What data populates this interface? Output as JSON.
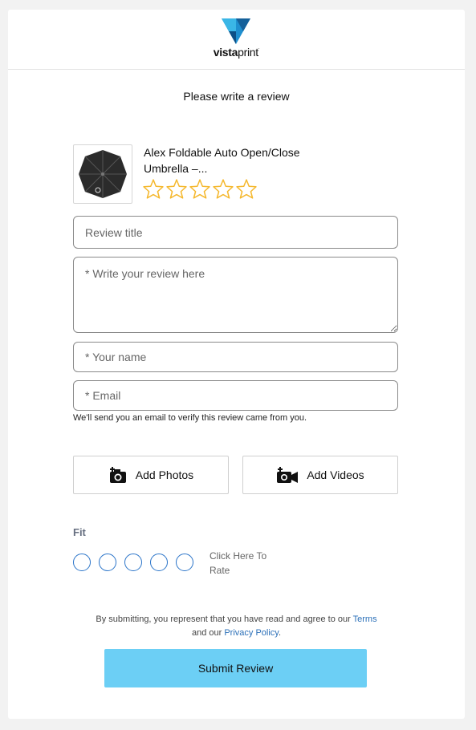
{
  "brand": {
    "name_bold": "vista",
    "name_light": "print",
    "reg_mark": "."
  },
  "heading": "Please write a review",
  "product": {
    "name": "Alex Foldable Auto Open/Close Umbrella –...",
    "rating_stars": 5,
    "thumbnail_icon": "umbrella-image"
  },
  "form": {
    "review_title_placeholder": "Review title",
    "review_body_placeholder": "* Write your review here",
    "name_placeholder": "* Your name",
    "email_placeholder": "* Email",
    "email_note": "We'll send you an email to verify this review came from you."
  },
  "media": {
    "add_photos_label": "Add Photos",
    "add_videos_label": "Add Videos"
  },
  "fit": {
    "label": "Fit",
    "options": 5,
    "hint": "Click Here To Rate"
  },
  "legal": {
    "prefix": "By submitting, you represent that you have read and agree to our",
    "terms_link": "Terms",
    "middle": "and our",
    "privacy_link": "Privacy Policy",
    "suffix": "."
  },
  "submit_label": "Submit Review",
  "colors": {
    "accent": "#6ccff5",
    "link": "#2a6fb8",
    "star": "#f5b82e",
    "radio": "#2a74c9"
  }
}
